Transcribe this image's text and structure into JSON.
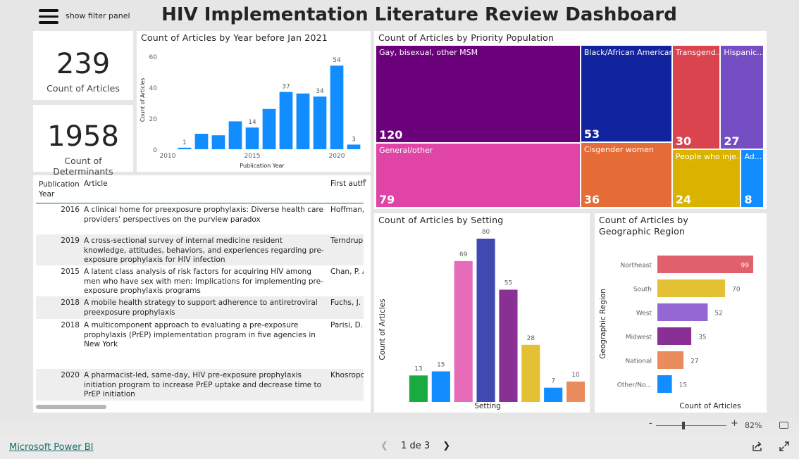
{
  "header": {
    "filter_label": "show filter panel",
    "title": "HIV Implementation Literature Review Dashboard"
  },
  "kpis": [
    {
      "value": "239",
      "label": "Count of Articles"
    },
    {
      "value": "1958",
      "label": "Count of Determinants"
    }
  ],
  "year_chart": {
    "title": "Count of Articles by Year before Jan 2021",
    "chart_data": {
      "type": "bar",
      "title": "Count of Articles by Year before Jan 2021",
      "xlabel": "Publication Year",
      "ylabel": "Count of Articles",
      "x": [
        2011,
        2012,
        2013,
        2014,
        2015,
        2016,
        2017,
        2018,
        2019,
        2020,
        2021
      ],
      "values": [
        1,
        10,
        9,
        18,
        14,
        26,
        37,
        36,
        34,
        54,
        3
      ],
      "data_labels": {
        "2011": "1",
        "2015": "14",
        "2017": "37",
        "2019": "34",
        "2020": "54",
        "2021": "3"
      },
      "x_ticks": [
        "2010",
        "2015",
        "2020"
      ],
      "y_ticks": [
        "0",
        "20",
        "40",
        "60"
      ],
      "ylim": [
        0,
        60
      ],
      "color": "#118dff"
    }
  },
  "priority_population": {
    "title": "Count of Articles by Priority Population",
    "cells": [
      {
        "label": "Gay, bisexual, other MSM",
        "value": "120",
        "color": "#6b007b"
      },
      {
        "label": "General/other",
        "value": "79",
        "color": "#e044a7"
      },
      {
        "label": "Black/African American",
        "value": "53",
        "color": "#12239e"
      },
      {
        "label": "Cisgender women",
        "value": "36",
        "color": "#e66c37"
      },
      {
        "label": "Transgend...",
        "value": "30",
        "color": "#d9444f"
      },
      {
        "label": "Hispanic...",
        "value": "27",
        "color": "#744ec2"
      },
      {
        "label": "People who inje...",
        "value": "24",
        "color": "#d9b300"
      },
      {
        "label": "Ad...",
        "value": "8",
        "color": "#118dff"
      }
    ]
  },
  "table": {
    "headers": [
      "Publication Year",
      "Article",
      "First auth"
    ],
    "rows": [
      {
        "year": "2016",
        "article": "A clinical home for preexposure prophylaxis: Diverse health care providers' perspectives on the purview paradox",
        "author": "Hoffman,"
      },
      {
        "year": "2019",
        "article": "A cross-sectional survey of internal medicine resident knowledge, attitudes, behaviors, and experiences regarding pre-exposure prophylaxis for HIV infection",
        "author": "Terndrup,"
      },
      {
        "year": "2015",
        "article": "A latent class analysis of risk factors for acquiring HIV among men who have sex with men: Implications for implementing pre-exposure prophylaxis programs",
        "author": "Chan, P. A"
      },
      {
        "year": "2018",
        "article": "A mobile health strategy to support adherence to antiretroviral preexposure prophylaxis",
        "author": "Fuchs, J. D"
      },
      {
        "year": "2018",
        "article": "A multicomponent approach to evaluating a pre-exposure prophylaxis (PrEP) implementation program in five agencies in New York",
        "author": "Parisi, D."
      },
      {
        "year": "2020",
        "article": "A pharmacist-led, same-day, HIV pre-exposure prophylaxis initiation program to increase PrEP uptake and decrease time to PrEP initiation",
        "author": "Khosropo"
      }
    ]
  },
  "setting_chart": {
    "title": "Count of Articles by Setting",
    "chart_data": {
      "type": "bar",
      "title": "Count of Articles by Setting",
      "xlabel": "Setting",
      "ylabel": "Count of Articles",
      "values": [
        13,
        15,
        69,
        80,
        55,
        28,
        7,
        10
      ],
      "colors": [
        "#1aab40",
        "#118dff",
        "#e66cb9",
        "#3f4ab0",
        "#8a2f94",
        "#e3c034",
        "#118dff",
        "#ea8c5c"
      ],
      "ylim": [
        0,
        80
      ]
    }
  },
  "region_chart": {
    "title": "Count of Articles by Geographic Region",
    "chart_data": {
      "type": "bar",
      "orientation": "horizontal",
      "title": "Count of Articles by Geographic Region",
      "xlabel": "Count of Articles",
      "ylabel": "Geographic Region",
      "categories": [
        "Northeast",
        "South",
        "West",
        "Midwest",
        "National",
        "Other/No..."
      ],
      "values": [
        99,
        70,
        52,
        35,
        27,
        15
      ],
      "colors": [
        "#e0606e",
        "#e3c034",
        "#9467d4",
        "#8a2f94",
        "#ea8c5c",
        "#118dff"
      ],
      "xlim": [
        0,
        99
      ]
    }
  },
  "zoom": {
    "minus": "-",
    "plus": "+",
    "level": "82%"
  },
  "footer": {
    "brand": "Microsoft Power BI",
    "page": "1 de 3"
  }
}
